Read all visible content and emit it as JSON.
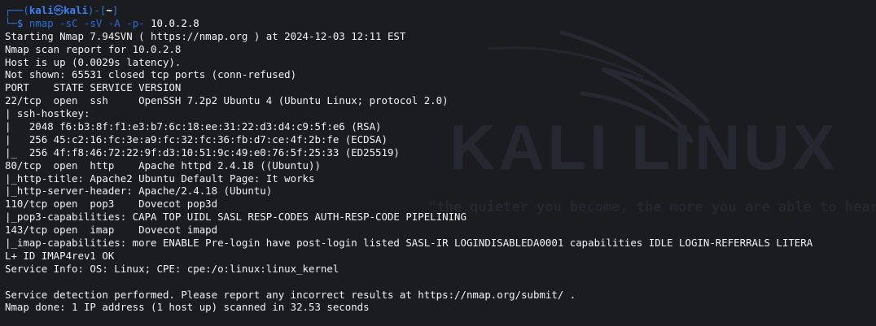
{
  "prompt": {
    "tree_top": "┌──(",
    "user": "kali",
    "at_symbol": "㉿",
    "host": "kali",
    "mid": ")-[",
    "cwd": "~",
    "end": "]",
    "tree_bottom": "└─",
    "dollar": "$",
    "command_program": "nmap",
    "command_flags": "-sC -sV -A -p-",
    "command_target": "10.0.2.8"
  },
  "output": [
    "Starting Nmap 7.94SVN ( https://nmap.org ) at 2024-12-03 12:11 EST",
    "Nmap scan report for 10.0.2.8",
    "Host is up (0.0029s latency).",
    "Not shown: 65531 closed tcp ports (conn-refused)",
    "PORT    STATE SERVICE VERSION",
    "22/tcp  open  ssh     OpenSSH 7.2p2 Ubuntu 4 (Ubuntu Linux; protocol 2.0)",
    "| ssh-hostkey:",
    "|   2048 f6:b3:8f:f1:e3:b7:6c:18:ee:31:22:d3:d4:c9:5f:e6 (RSA)",
    "|   256 45:c2:16:fc:3e:a9:fc:32:fc:36:fb:d7:ce:4f:2b:fe (ECDSA)",
    "|_  256 4f:f8:46:72:22:9f:d3:10:51:9c:49:e0:76:5f:25:33 (ED25519)",
    "80/tcp  open  http    Apache httpd 2.4.18 ((Ubuntu))",
    "|_http-title: Apache2 Ubuntu Default Page: It works",
    "|_http-server-header: Apache/2.4.18 (Ubuntu)",
    "110/tcp open  pop3    Dovecot pop3d",
    "|_pop3-capabilities: CAPA TOP UIDL SASL RESP-CODES AUTH-RESP-CODE PIPELINING",
    "143/tcp open  imap    Dovecot imapd",
    "|_imap-capabilities: more ENABLE Pre-login have post-login listed SASL-IR LOGINDISABLEDA0001 capabilities IDLE LOGIN-REFERRALS LITERA",
    "L+ ID IMAP4rev1 OK",
    "Service Info: OS: Linux; CPE: cpe:/o:linux:linux_kernel",
    "",
    "Service detection performed. Please report any incorrect results at https://nmap.org/submit/ .",
    "Nmap done: 1 IP address (1 host up) scanned in 32.53 seconds"
  ],
  "wallpaper": {
    "logo_text": "KALI LINUX",
    "tagline": "\"the quieter you become, the more you are able to hear\""
  },
  "colors": {
    "background": "#1b1c20",
    "prompt_blue": "#3b82f6",
    "command_blue": "#2b6ed8",
    "text": "#f2f2f2",
    "watermark": "#2a2d36"
  }
}
